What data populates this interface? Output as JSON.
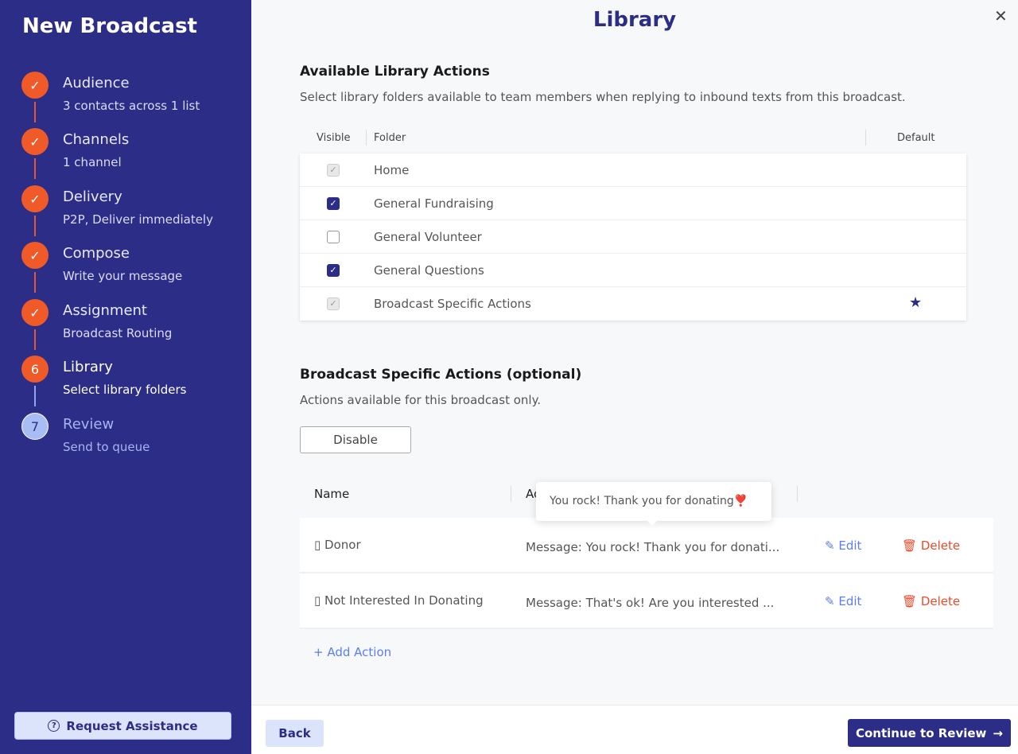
{
  "sidebar": {
    "title": "New Broadcast",
    "steps": [
      {
        "marker": "✓",
        "title": "Audience",
        "subtitle": "3 contacts across 1 list"
      },
      {
        "marker": "✓",
        "title": "Channels",
        "subtitle": "1 channel"
      },
      {
        "marker": "✓",
        "title": "Delivery",
        "subtitle": "P2P, Deliver immediately"
      },
      {
        "marker": "✓",
        "title": "Compose",
        "subtitle": "Write your message"
      },
      {
        "marker": "✓",
        "title": "Assignment",
        "subtitle": "Broadcast Routing"
      },
      {
        "marker": "6",
        "title": "Library",
        "subtitle": "Select library folders"
      },
      {
        "marker": "7",
        "title": "Review",
        "subtitle": "Send to queue"
      }
    ],
    "request_label": "Request Assistance"
  },
  "header": {
    "title": "Library",
    "close": "✕"
  },
  "library": {
    "heading": "Available Library Actions",
    "description": "Select library folders available to team members when replying to inbound texts from this broadcast.",
    "columns": {
      "visible": "Visible",
      "folder": "Folder",
      "default": "Default"
    },
    "folders": [
      {
        "name": "Home",
        "state": "disabled-checked"
      },
      {
        "name": "General Fundraising",
        "state": "checked"
      },
      {
        "name": "General Volunteer",
        "state": "unchecked"
      },
      {
        "name": "General Questions",
        "state": "checked"
      },
      {
        "name": "Broadcast Specific Actions",
        "state": "disabled-checked",
        "default": true
      }
    ]
  },
  "specific": {
    "heading": "Broadcast Specific Actions (optional)",
    "description": "Actions available for this broadcast only.",
    "disable_label": "Disable",
    "columns": {
      "name": "Name",
      "action": "Action"
    },
    "actions": [
      {
        "name": "Donor",
        "message": "Message: You rock! Thank you for donati...",
        "edit": "Edit",
        "delete": "Delete"
      },
      {
        "name": "Not Interested In Donating",
        "message": "Message: That's ok! Are you interested ...",
        "edit": "Edit",
        "delete": "Delete"
      }
    ],
    "tooltip": "You rock! Thank you for donating❣️",
    "add_label": "Add Action"
  },
  "footer": {
    "back": "Back",
    "continue": "Continue to Review"
  }
}
